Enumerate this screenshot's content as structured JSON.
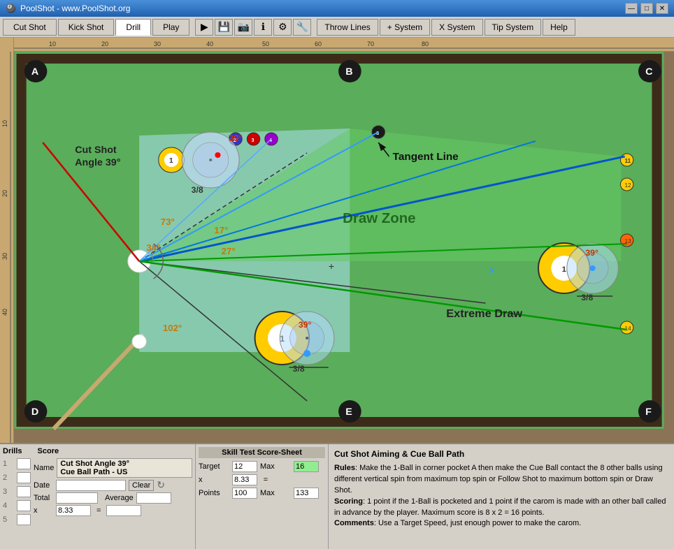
{
  "titlebar": {
    "icon": "🎱",
    "title": "PoolShot - www.PoolShot.org",
    "min_btn": "—",
    "max_btn": "□",
    "close_btn": "✕"
  },
  "menubar": {
    "tabs": [
      "Cut Shot",
      "Kick Shot",
      "Drill",
      "Play"
    ],
    "active_tab": "Drill",
    "icon_btns": [
      "▶",
      "💾",
      "📷",
      "ℹ",
      "⚙",
      "🔧"
    ],
    "text_btns": [
      "Throw Lines",
      "+ System",
      "X System",
      "Tip System",
      "Help"
    ]
  },
  "diagram": {
    "corner_labels": [
      "A",
      "B",
      "C",
      "D",
      "E",
      "F"
    ],
    "angle_labels": [
      "39°",
      "73°",
      "34°",
      "17°",
      "27°",
      "102°",
      "39°",
      "3/8",
      "3/8",
      "3/8"
    ],
    "zone_label": "Draw Zone",
    "tangent_label": "Tangent Line",
    "extreme_draw_label": "Extreme Draw",
    "cut_shot_label": "Cut Shot\nAngle 39°"
  },
  "score_panel": {
    "score_label": "Score",
    "drills_label": "Drills",
    "rows": [
      1,
      2,
      3,
      4,
      5
    ],
    "name_line1": "Cut Shot Angle 39°",
    "name_line2": "Cue Ball Path - US",
    "date_label": "Date",
    "clear_label": "Clear",
    "total_label": "Total",
    "average_label": "Average",
    "x_label": "x",
    "eq_label": "=",
    "x_value": "8.33"
  },
  "scoresheet": {
    "title": "Skill Test Score-Sheet",
    "target_label": "Target",
    "target_value": "12",
    "max_label": "Max",
    "max_value": "16",
    "x_label": "x",
    "x_value": "8.33",
    "eq_label": "=",
    "points_label": "Points",
    "points_value": "100",
    "points_max_label": "Max",
    "points_max_value": "133"
  },
  "description": {
    "title": "Cut Shot Aiming & Cue Ball Path",
    "rules_label": "Rules",
    "rules_text": ": Make the 1-Ball in corner pocket A then make the Cue Ball contact the 8 other balls using different vertical spin from maximum top spin or Follow Shot to maximum bottom spin or Draw Shot.",
    "scoring_label": "Scoring",
    "scoring_text": ": 1 point if the 1-Ball is pocketed and 1 point if the carom is made with an other ball called in advance by the player. Maximum score is 8 x 2 = 16 points.",
    "comments_label": "Comments",
    "comments_text": ": Use a Target Speed, just enough power to make the carom."
  }
}
